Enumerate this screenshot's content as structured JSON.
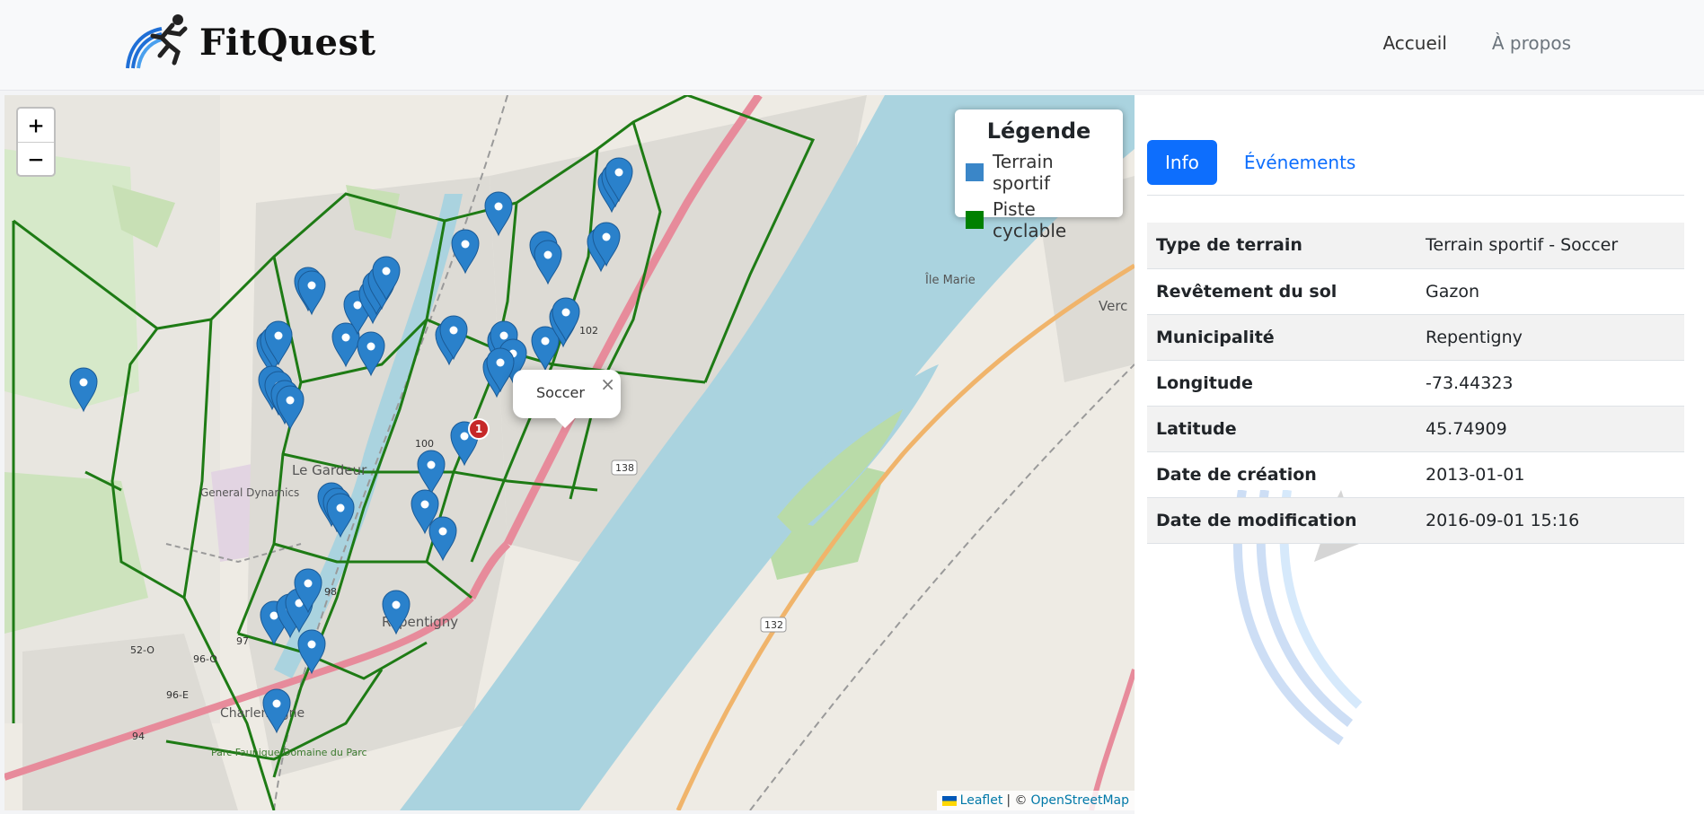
{
  "navbar": {
    "brand_name": "FitQuest",
    "links": [
      "Accueil",
      "À propos"
    ]
  },
  "map": {
    "zoom_in": "+",
    "zoom_out": "−",
    "place_labels": [
      "Le Gardeur",
      "General Dynamics",
      "Repentigny",
      "Charlemagne",
      "Île Marie",
      "Verc",
      "Parc Faunique Domaine du Parc"
    ],
    "route_labels": [
      "100",
      "102",
      "138",
      "132",
      "52-O",
      "96-O",
      "96-E",
      "94",
      "97",
      "98",
      "1"
    ],
    "legend": {
      "title": "Légende",
      "items": [
        {
          "label": "Terrain sportif",
          "color": "#3a86c8"
        },
        {
          "label": "Piste cyclable",
          "color": "#008000"
        }
      ]
    },
    "popup": {
      "text": "Soccer",
      "close": "×"
    },
    "attribution": {
      "leaflet": "Leaflet",
      "separator": "| ©",
      "osm": "OpenStreetMap"
    },
    "marker_color": "#2a81cb",
    "bike_path_color": "#1e7b15",
    "river_color": "#aad3df"
  },
  "panel": {
    "tabs": [
      {
        "label": "Info",
        "active": true
      },
      {
        "label": "Événements",
        "active": false
      }
    ],
    "rows": [
      {
        "key": "Type de terrain",
        "value": "Terrain sportif - Soccer"
      },
      {
        "key": "Revêtement du sol",
        "value": "Gazon"
      },
      {
        "key": "Municipalité",
        "value": "Repentigny"
      },
      {
        "key": "Longitude",
        "value": "-73.44323"
      },
      {
        "key": "Latitude",
        "value": "45.74909"
      },
      {
        "key": "Date de création",
        "value": "2013-01-01"
      },
      {
        "key": "Date de modification",
        "value": "2016-09-01 15:16"
      }
    ]
  }
}
